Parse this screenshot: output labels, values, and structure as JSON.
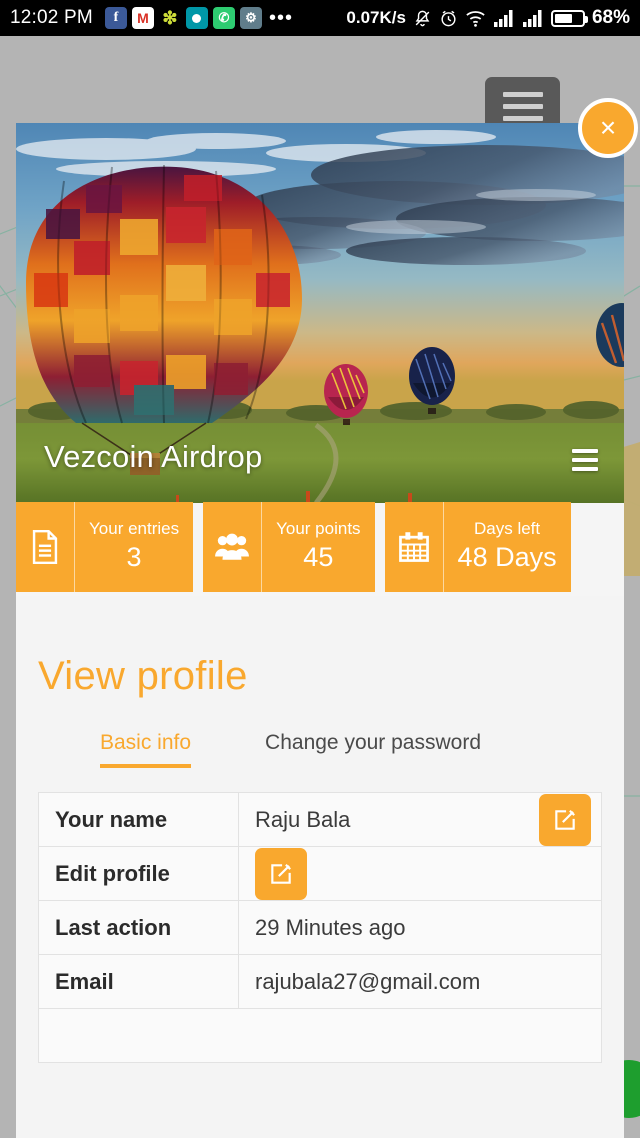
{
  "status_bar": {
    "clock": "12:02 PM",
    "app_icons": [
      {
        "name": "facebook-icon",
        "glyph": "f"
      },
      {
        "name": "gmail-icon",
        "glyph": "M"
      },
      {
        "name": "flash-icon",
        "glyph": "❇"
      },
      {
        "name": "camera-icon",
        "glyph": ""
      },
      {
        "name": "phone-icon",
        "glyph": "✆"
      },
      {
        "name": "settings-icon",
        "glyph": "⚙"
      }
    ],
    "overflow": "•••",
    "net_speed": "0.07K/s",
    "mute_icon": "🔕",
    "alarm_icon": "⏱",
    "wifi_icon": "📶",
    "signal_one": "▂▃▅▇",
    "signal_two": "▂▃▅▇",
    "battery_percent": "68%"
  },
  "overlay": {
    "hamburger_button": "menu",
    "close_button": "×",
    "fab_button": "add"
  },
  "hero": {
    "title": "Vezcoin Airdrop",
    "menu_icon": "hamburger-icon"
  },
  "stats": [
    {
      "icon": "document-icon",
      "label": "Your entries",
      "value": "3"
    },
    {
      "icon": "users-icon",
      "label": "Your points",
      "value": "45"
    },
    {
      "icon": "calendar-icon",
      "label": "Days left",
      "value": "48 Days"
    }
  ],
  "profile": {
    "heading": "View profile",
    "tabs": [
      {
        "label": "Basic info",
        "active": true
      },
      {
        "label": "Change your password",
        "active": false
      }
    ],
    "rows": [
      {
        "label": "Your name",
        "value": "Raju Bala",
        "has_edit_right": true
      },
      {
        "label": "Edit profile",
        "value": "",
        "has_edit_inline": true
      },
      {
        "label": "Last action",
        "value": "29 Minutes ago"
      },
      {
        "label": "Email",
        "value": "rajubala27@gmail.com"
      },
      {
        "label": "",
        "value": ""
      }
    ]
  },
  "colors": {
    "accent_orange": "#f9a82e",
    "modal_bg": "#f4f4f4",
    "scrim": "#b4b4b4",
    "fab_green": "#1e9e2e",
    "status_bg": "#000000"
  }
}
